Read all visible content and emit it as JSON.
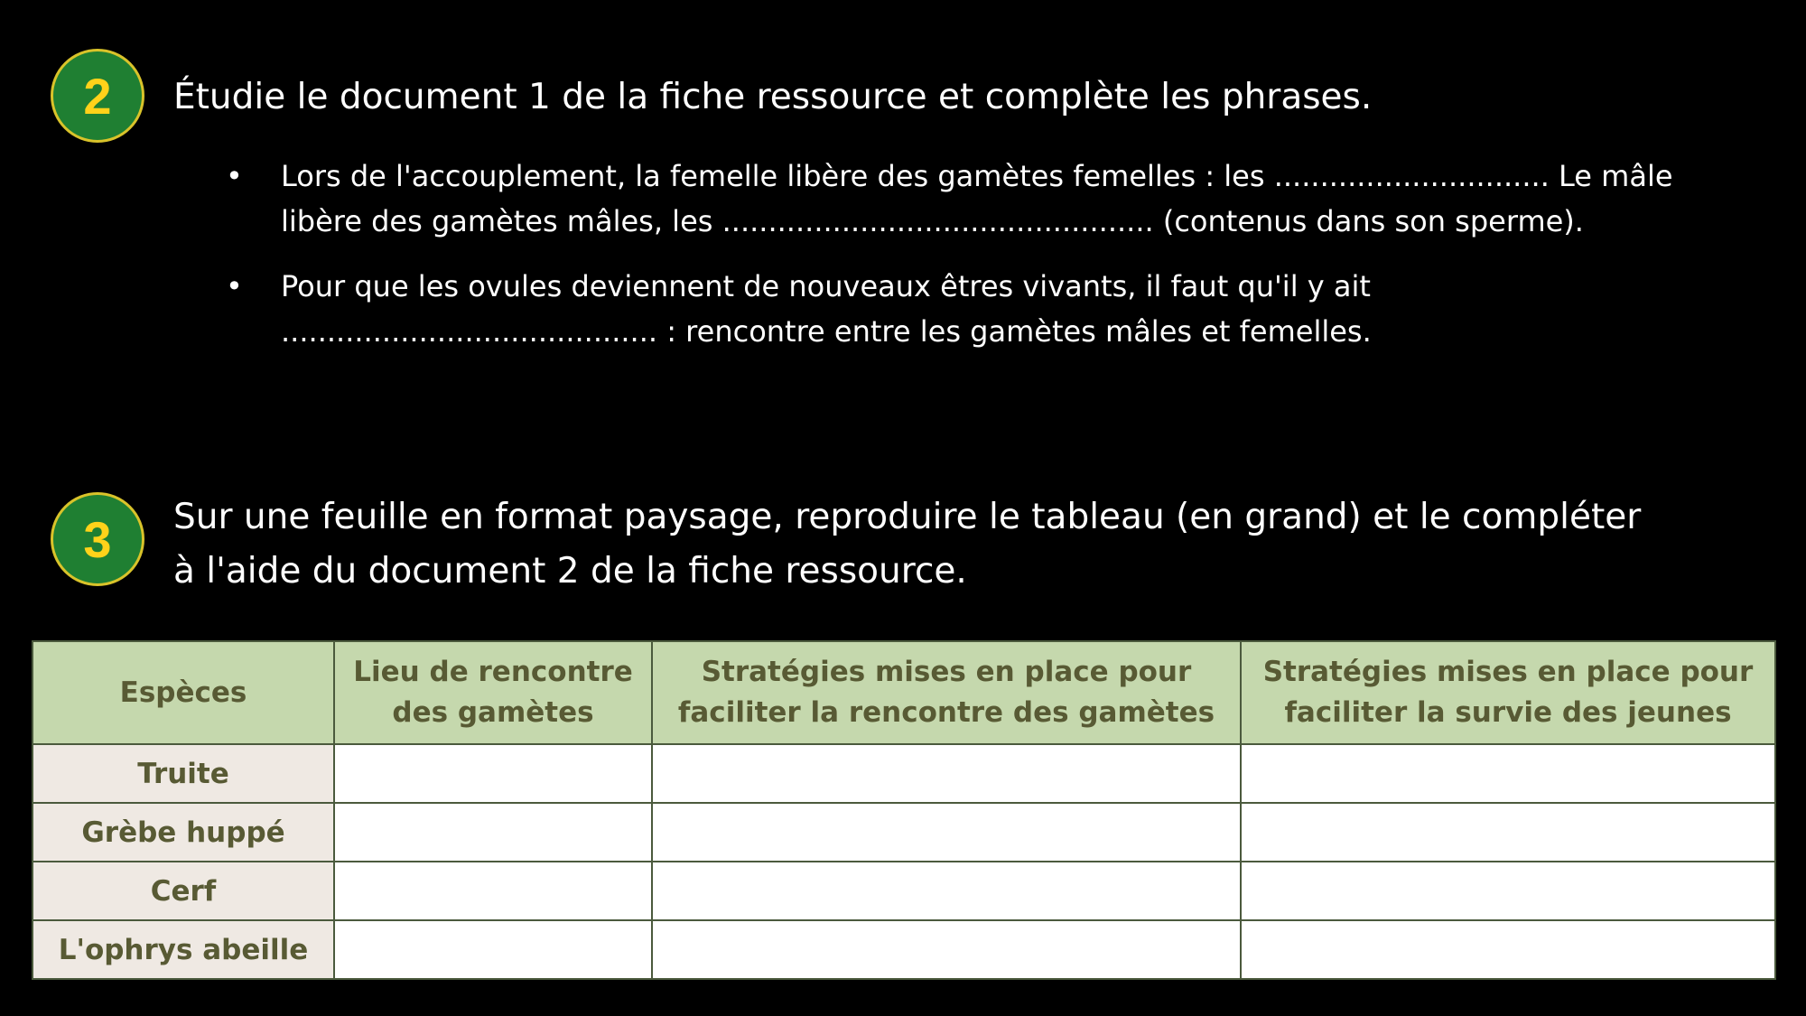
{
  "section2": {
    "number": "2",
    "heading": "Étudie le document 1 de la fiche ressource et complète les phrases.",
    "bullets": [
      {
        "line1": "Lors de l'accouplement, la femelle libère des gamètes femelles : les .............................. Le mâle",
        "line2": "libère des gamètes mâles, les ............................................... (contenus dans son sperme)."
      },
      {
        "line1": "Pour que les ovules deviennent de nouveaux êtres vivants, il faut qu'il y ait",
        "line2": "......................................... : rencontre entre les gamètes mâles et femelles."
      }
    ]
  },
  "section3": {
    "number": "3",
    "heading_line1": "Sur une feuille en format paysage, reproduire le tableau (en grand) et le compléter",
    "heading_line2": "à l'aide du document 2 de la fiche ressource."
  },
  "table": {
    "headers": [
      "Espèces",
      "Lieu de rencontre des gamètes",
      "Stratégies mises en place pour faciliter la rencontre des gamètes",
      "Stratégies mises en place pour faciliter la survie des jeunes"
    ],
    "rows": [
      "Truite",
      "Grèbe huppé",
      "Cerf",
      "L'ophrys abeille"
    ]
  },
  "colors": {
    "badge_fill": "#1f7f32",
    "badge_border": "#d9c32a",
    "badge_number": "#ffd21a",
    "header_fill": "#c5d8ad",
    "species_fill": "#efe9e3"
  }
}
